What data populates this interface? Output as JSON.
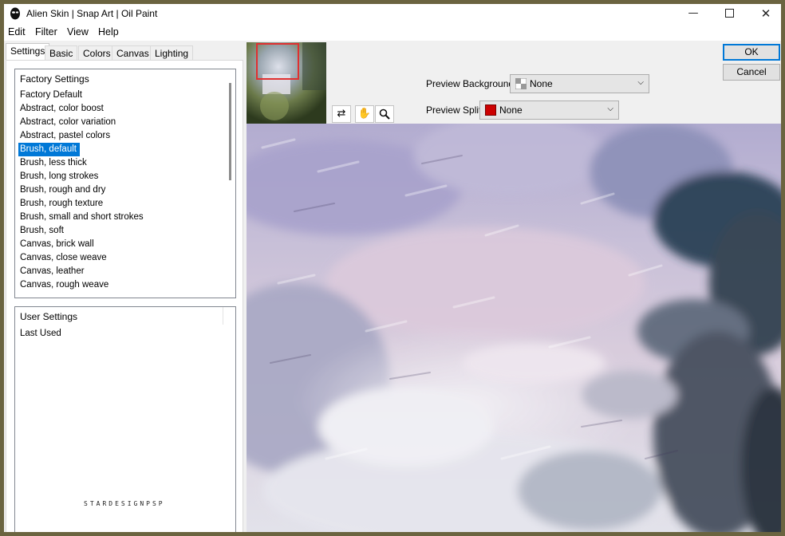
{
  "window": {
    "title": "Alien Skin | Snap Art | Oil Paint",
    "minimize_icon": "minimize-icon",
    "maximize_icon": "maximize-icon",
    "close_icon": "close-icon"
  },
  "menu": [
    "Edit",
    "Filter",
    "View",
    "Help"
  ],
  "tabs": [
    "Settings",
    "Basic",
    "Colors",
    "Canvas",
    "Lighting"
  ],
  "active_tab": "Settings",
  "factory": {
    "header": "Factory Settings",
    "items": [
      "Factory Default",
      "Abstract, color boost",
      "Abstract, color variation",
      "Abstract, pastel colors",
      "Brush, default",
      "Brush, less thick",
      "Brush, long strokes",
      "Brush, rough and dry",
      "Brush, rough texture",
      "Brush, small and short strokes",
      "Brush, soft",
      "Canvas, brick wall",
      "Canvas, close weave",
      "Canvas, leather",
      "Canvas, rough weave"
    ],
    "selected": "Brush, default"
  },
  "user": {
    "header": "User Settings",
    "items": [
      "Last Used"
    ]
  },
  "watermark": "STARDESIGNPSP",
  "preview_background": {
    "label": "Preview Background:",
    "value": "None",
    "swatch_icon": "checkerboard-swatch-icon"
  },
  "preview_split": {
    "label": "Preview Split:",
    "value": "None",
    "swatch_color": "#cc0000"
  },
  "tools": [
    "split-compare-icon",
    "hand-pan-icon",
    "zoom-icon"
  ],
  "buttons": {
    "ok": "OK",
    "cancel": "Cancel"
  },
  "colors": {
    "frame": "#6b6440",
    "selection": "#0078d7",
    "thumb_marker": "#e03030"
  }
}
